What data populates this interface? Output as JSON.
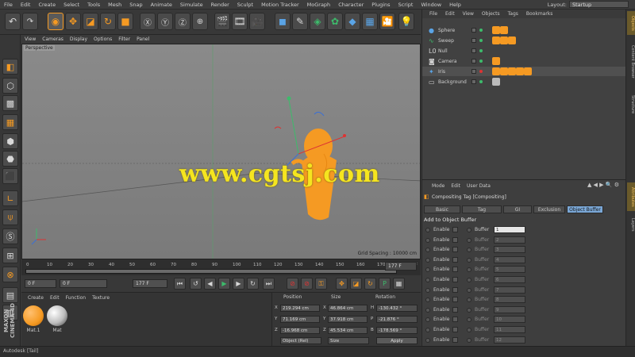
{
  "menubar": {
    "items": [
      "File",
      "Edit",
      "Create",
      "Select",
      "Tools",
      "Mesh",
      "Snap",
      "Animate",
      "Simulate",
      "Render",
      "Sculpt",
      "Motion Tracker",
      "MoGraph",
      "Character",
      "Plugins",
      "Script",
      "Window",
      "Help"
    ],
    "layout_label": "Layout:",
    "layout_value": "Startup"
  },
  "viewport": {
    "menu": [
      "View",
      "Cameras",
      "Display",
      "Options",
      "Filter",
      "Panel"
    ],
    "label": "Perspective",
    "grid_spacing": "Grid Spacing : 10000 cm"
  },
  "timeline": {
    "ticks": [
      "0",
      "10",
      "20",
      "30",
      "40",
      "50",
      "60",
      "70",
      "80",
      "90",
      "100",
      "110",
      "120",
      "130",
      "140",
      "150",
      "160",
      "170"
    ],
    "end_label": "0 F"
  },
  "transport": {
    "start_field": "0 F",
    "current_field": "0 F",
    "end_field": "177 F",
    "end_field2": "177 F"
  },
  "materials": {
    "menu": [
      "Create",
      "Edit",
      "Function",
      "Texture"
    ],
    "items": [
      {
        "name": "Mat.1",
        "color": "#f59a23"
      },
      {
        "name": "Mat",
        "color": "#bdbdbd"
      }
    ]
  },
  "coordinates": {
    "headers": [
      "Position",
      "Size",
      "Rotation"
    ],
    "axes": [
      "X",
      "Y",
      "Z"
    ],
    "position": [
      "219.294 cm",
      "71.169 cm",
      "-16.968 cm"
    ],
    "size": [
      "46.864 cm",
      "37.918 cm",
      "45.534 cm"
    ],
    "size_labels": [
      "H",
      "P",
      "B"
    ],
    "rotation": [
      "-130.432 °",
      "-21.876 °",
      "-178.569 °"
    ],
    "mode_select": "Object (Rel)",
    "size_select": "Size",
    "apply_label": "Apply"
  },
  "object_manager": {
    "menu": [
      "File",
      "Edit",
      "View",
      "Objects",
      "Tags",
      "Bookmarks"
    ],
    "objects": [
      {
        "name": "Sphere",
        "icon": "sphere-icon"
      },
      {
        "name": "Sweep",
        "icon": "sweep-icon"
      },
      {
        "name": "Null",
        "icon": "null-icon"
      },
      {
        "name": "Camera",
        "icon": "camera-icon"
      },
      {
        "name": "Iris",
        "icon": "light-icon"
      },
      {
        "name": "Background",
        "icon": "background-icon"
      }
    ]
  },
  "right_strip": {
    "tabs_top": [
      "Objects",
      "Content Browser",
      "Structure"
    ],
    "tabs_bottom": [
      "Attributes",
      "Layers"
    ]
  },
  "attributes": {
    "menu": [
      "Mode",
      "Edit",
      "User Data"
    ],
    "title": "Compositing Tag [Compositing]",
    "tabs": [
      "Basic",
      "Tag",
      "GI",
      "Exclusion",
      "Object Buffer"
    ],
    "active_tab": "Object Buffer",
    "section": "Add to Object Buffer",
    "rows": [
      {
        "enable": "Enable",
        "buffer": "Buffer",
        "value": "1",
        "on": true
      },
      {
        "enable": "Enable",
        "buffer": "Buffer",
        "value": "2",
        "on": false
      },
      {
        "enable": "Enable",
        "buffer": "Buffer",
        "value": "3",
        "on": false
      },
      {
        "enable": "Enable",
        "buffer": "Buffer",
        "value": "4",
        "on": false
      },
      {
        "enable": "Enable",
        "buffer": "Buffer",
        "value": "5",
        "on": false
      },
      {
        "enable": "Enable",
        "buffer": "Buffer",
        "value": "6",
        "on": false
      },
      {
        "enable": "Enable",
        "buffer": "Buffer",
        "value": "7",
        "on": false
      },
      {
        "enable": "Enable",
        "buffer": "Buffer",
        "value": "8",
        "on": false
      },
      {
        "enable": "Enable",
        "buffer": "Buffer",
        "value": "9",
        "on": false
      },
      {
        "enable": "Enable",
        "buffer": "Buffer",
        "value": "10",
        "on": false
      },
      {
        "enable": "Enable",
        "buffer": "Buffer",
        "value": "11",
        "on": false
      },
      {
        "enable": "Enable",
        "buffer": "Buffer",
        "value": "12",
        "on": false
      }
    ]
  },
  "statusbar": {
    "text": "Autodesk [Tail]"
  },
  "watermark": "www.cgtsj.com",
  "branding": "MAXON CINEMA 4D"
}
